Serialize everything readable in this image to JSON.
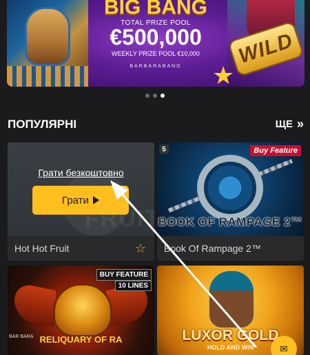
{
  "banner": {
    "title": "BIG BANG",
    "total_label": "TOTAL PRIZE POOL",
    "amount": "€500,000",
    "weekly_label": "WEEKLY PRIZE POOL €10,000",
    "brand": "BARBARABANG",
    "wild_text": "WILD"
  },
  "carousel": {
    "slides": 3,
    "active_index": 2
  },
  "section": {
    "title": "ПОПУЛЯРНІ",
    "more_label": "ЩЕ",
    "more_icon": "chevron-double-right-icon"
  },
  "games": [
    {
      "name": "Hot Hot Fruit",
      "free_play_label": "Грати безкоштовно",
      "play_label": "Грати",
      "watermark": "FRUIT",
      "favorite_icon": "star-outline-icon"
    },
    {
      "name": "Book Of Rampage 2™",
      "badge": "Buy Feature",
      "provider_number": "5",
      "logo": "BOOK OF RAMPAGE 2™"
    },
    {
      "badge": "BUY FEATURE",
      "lines_badge": "10 LINES",
      "logo": "RELIQUARY OF RA",
      "brand": "BAR BARA"
    },
    {
      "logo": "LUXOR GOLD",
      "logo_sub": "HOLD AND WIN"
    }
  ],
  "colors": {
    "background": "#1b1b1d",
    "accent": "#ffbf1f",
    "card": "#2a2a2d"
  }
}
